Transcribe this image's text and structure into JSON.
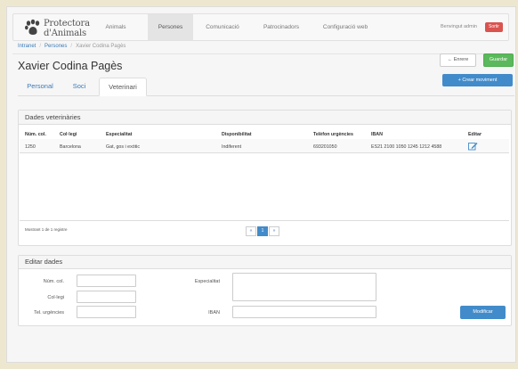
{
  "logo": {
    "line1": "Protectora",
    "line2": "d'Animals"
  },
  "nav": {
    "items": [
      "Animals",
      "Persones",
      "Comunicació",
      "Patrocinadors",
      "Configuració web"
    ],
    "user": "Benvingut admin",
    "logout": "Sortir"
  },
  "breadcrumb": [
    "Intranet",
    "Persones",
    "Xavier Codina Pagès"
  ],
  "title": "Xavier Codina Pagès",
  "buttons": {
    "back": "Enrere",
    "save": "Guardar",
    "new_movement": "Crear moviment",
    "modify": "Modificar"
  },
  "tabs": [
    "Personal",
    "Soci",
    "Veterinari"
  ],
  "vet_panel": {
    "title": "Dades veterinàries",
    "columns": [
      "Núm. col.",
      "Col·legi",
      "Especialitat",
      "Disponibilitat",
      "Telèfon urgències",
      "IBAN",
      "Editar"
    ],
    "rows": [
      [
        "1250",
        "Barcelona",
        "Gat, gos i exòtic",
        "Indiferent",
        "693201050",
        "ES21 2100 1050 1245 1212 4588"
      ]
    ],
    "showing": "Mostrant 1 de 1 registre",
    "pagination": [
      "«",
      "1",
      "»"
    ]
  },
  "edit_panel": {
    "title": "Editar dades",
    "labels": {
      "num_col": "Núm. col.",
      "college": "Col·legi",
      "phone": "Tel. urgències",
      "specialty": "Especialitat",
      "iban": "IBAN"
    }
  },
  "colors": {
    "primary": "#428bca",
    "success": "#5cb85c",
    "danger": "#d9534f",
    "background": "#eee7cf"
  }
}
